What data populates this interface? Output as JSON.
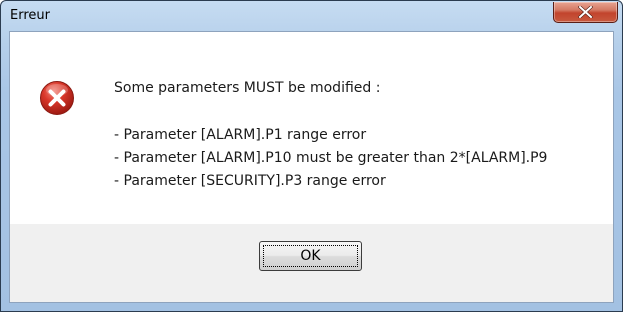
{
  "window": {
    "title": "Erreur",
    "close_icon": "close-icon"
  },
  "dialog": {
    "icon": "error-icon",
    "message": "Some parameters MUST be modified :",
    "errors": [
      "- Parameter [ALARM].P1 range error",
      "- Parameter [ALARM].P10 must be greater than 2*[ALARM].P9",
      "- Parameter [SECURITY].P3 range error"
    ],
    "ok_label": "OK"
  },
  "colors": {
    "titlebar": "#b5cfea",
    "close_button": "#c2442d",
    "error_icon": "#c6261b",
    "client_background": "#f0f0f0"
  }
}
